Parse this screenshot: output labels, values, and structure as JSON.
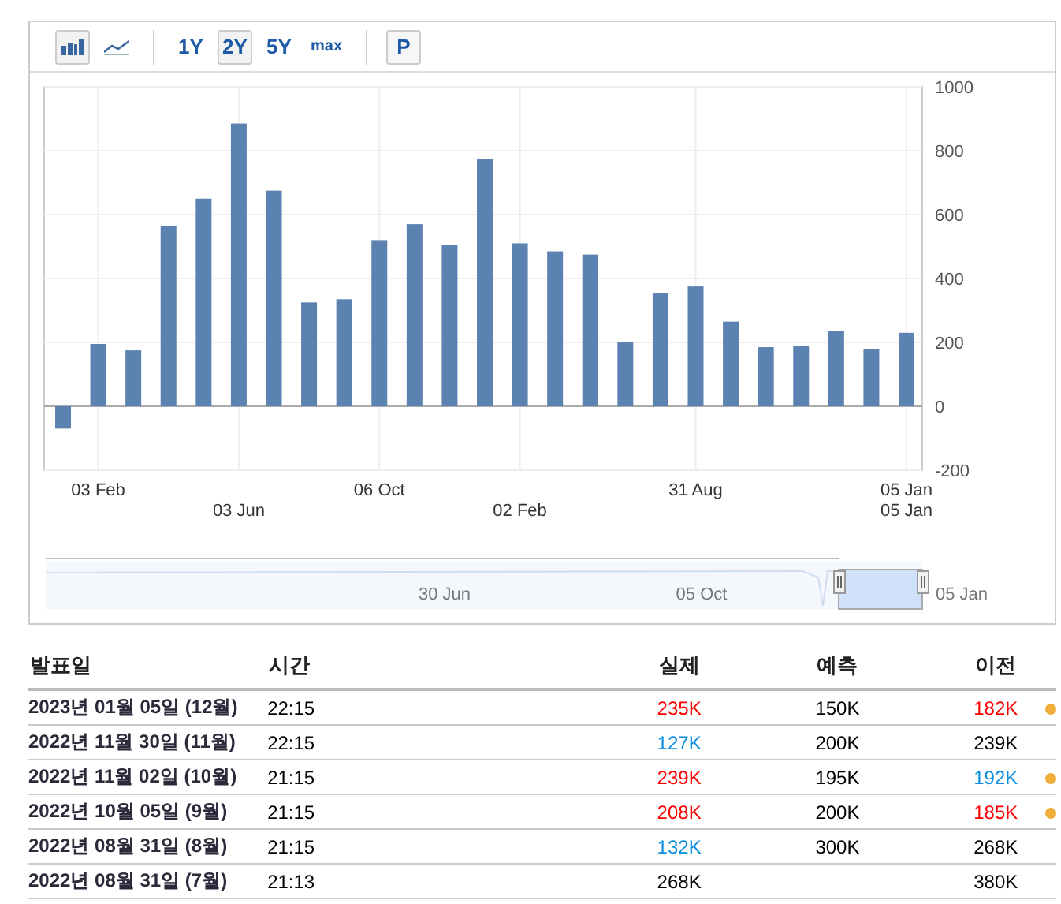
{
  "toolbar": {
    "chart_types": [
      {
        "kind": "bar",
        "selected": true
      },
      {
        "kind": "line",
        "selected": false
      }
    ],
    "ranges": [
      {
        "label": "1Y",
        "selected": false
      },
      {
        "label": "2Y",
        "selected": true
      },
      {
        "label": "5Y",
        "selected": false
      },
      {
        "label": "max",
        "selected": false
      }
    ],
    "extra_button": {
      "label": "P"
    }
  },
  "chart_data": {
    "type": "bar",
    "grid": true,
    "categories": [
      null,
      "03 Feb",
      null,
      null,
      null,
      "03 Jun",
      null,
      null,
      null,
      "06 Oct",
      null,
      null,
      null,
      "02 Feb",
      null,
      null,
      null,
      null,
      "31 Aug",
      null,
      null,
      null,
      null,
      null,
      "05 Jan"
    ],
    "series": [
      {
        "color": "#5b82b0",
        "values": [
          -70,
          195,
          175,
          565,
          650,
          885,
          675,
          325,
          335,
          520,
          570,
          505,
          775,
          510,
          485,
          475,
          200,
          355,
          375,
          265,
          185,
          190,
          235,
          180,
          230
        ]
      }
    ],
    "ylim": [
      -200,
      1000
    ],
    "yticks": [
      {
        "value": -200,
        "label": "-200"
      },
      {
        "value": 0,
        "label": "0"
      },
      {
        "value": 200,
        "label": "200"
      },
      {
        "value": 400,
        "label": "400"
      },
      {
        "value": 600,
        "label": "600"
      },
      {
        "value": 800,
        "label": "800"
      },
      {
        "value": 1000,
        "label": "1000"
      }
    ],
    "annotations": [
      "05 Jan"
    ]
  },
  "navigator": {
    "labels": [
      "30 Jun",
      "05 Oct",
      "05 Jan"
    ]
  },
  "table": {
    "columns": [
      "발표일",
      "시간",
      "실제",
      "예측",
      "이전"
    ],
    "rows": [
      {
        "date": "2023년 01월 05일 (12월)",
        "time": "22:15",
        "actual": {
          "text": "235K",
          "color": "#ff0000"
        },
        "forecast": "150K",
        "previous": {
          "text": "182K",
          "color": "#ff0000"
        },
        "revised": true
      },
      {
        "date": "2022년 11월 30일 (11월)",
        "time": "22:15",
        "actual": {
          "text": "127K",
          "color": "#0a8ee0"
        },
        "forecast": "200K",
        "previous": {
          "text": "239K",
          "color": "#000000"
        },
        "revised": false
      },
      {
        "date": "2022년 11월 02일 (10월)",
        "time": "21:15",
        "actual": {
          "text": "239K",
          "color": "#ff0000"
        },
        "forecast": "195K",
        "previous": {
          "text": "192K",
          "color": "#0a8ee0"
        },
        "revised": true
      },
      {
        "date": "2022년 10월 05일 (9월)",
        "time": "21:15",
        "actual": {
          "text": "208K",
          "color": "#ff0000"
        },
        "forecast": "200K",
        "previous": {
          "text": "185K",
          "color": "#ff0000"
        },
        "revised": true
      },
      {
        "date": "2022년 08월 31일 (8월)",
        "time": "21:15",
        "actual": {
          "text": "132K",
          "color": "#0a8ee0"
        },
        "forecast": "300K",
        "previous": {
          "text": "268K",
          "color": "#000000"
        },
        "revised": false
      },
      {
        "date": "2022년 08월 31일 (7월)",
        "time": "21:13",
        "actual": {
          "text": "268K",
          "color": "#000000"
        },
        "previous": {
          "text": "380K",
          "color": "#000000"
        },
        "revised": false
      }
    ]
  }
}
